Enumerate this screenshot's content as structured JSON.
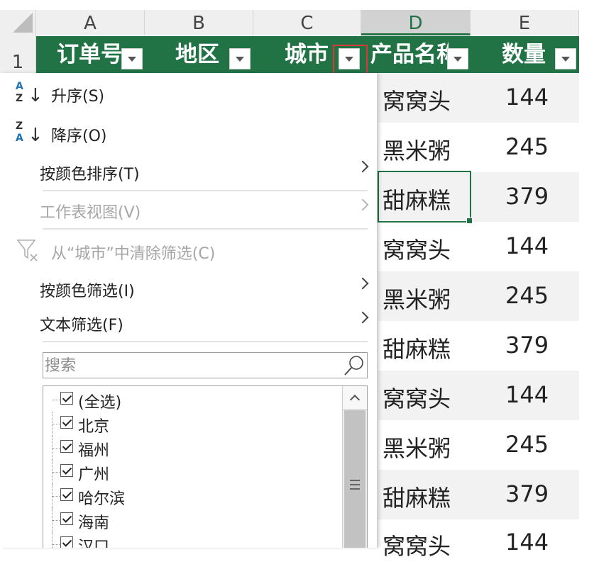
{
  "columns": [
    "A",
    "B",
    "C",
    "D",
    "E"
  ],
  "row_number": "1",
  "headers": [
    "订单号",
    "地区",
    "城市",
    "产品名称",
    "数量"
  ],
  "rows": [
    {
      "product": "窝窝头",
      "qty": "144"
    },
    {
      "product": "黑米粥",
      "qty": "245"
    },
    {
      "product": "甜麻糕",
      "qty": "379"
    },
    {
      "product": "窝窝头",
      "qty": "144"
    },
    {
      "product": "黑米粥",
      "qty": "245"
    },
    {
      "product": "甜麻糕",
      "qty": "379"
    },
    {
      "product": "窝窝头",
      "qty": "144"
    },
    {
      "product": "黑米粥",
      "qty": "245"
    },
    {
      "product": "甜麻糕",
      "qty": "379"
    },
    {
      "product": "窝窝头",
      "qty": "144"
    }
  ],
  "menu": {
    "sort_asc": "升序(S)",
    "sort_desc": "降序(O)",
    "sort_by_color": "按颜色排序(T)",
    "sheet_view": "工作表视图(V)",
    "clear_filter": "从“城市”中清除筛选(C)",
    "filter_by_color": "按颜色筛选(I)",
    "text_filter": "文本筛选(F)",
    "search_placeholder": "搜索",
    "sort_asc_icon": {
      "top": "A",
      "bottom": "Z"
    },
    "sort_desc_icon": {
      "top": "Z",
      "bottom": "A"
    },
    "items": [
      {
        "label": "(全选)",
        "checked": true
      },
      {
        "label": "北京",
        "checked": true
      },
      {
        "label": "福州",
        "checked": true
      },
      {
        "label": "广州",
        "checked": true
      },
      {
        "label": "哈尔滨",
        "checked": true
      },
      {
        "label": "海南",
        "checked": true
      },
      {
        "label": "汉口",
        "checked": true
      }
    ]
  },
  "colors": {
    "header_green": "#217346",
    "highlight_red": "#d9393a",
    "accent_blue": "#1e73b5"
  },
  "icons": [
    "sort-ascending-icon",
    "sort-descending-icon",
    "clear-filter-icon",
    "search-icon",
    "submenu-chevron-icon",
    "dropdown-arrow-icon",
    "scroll-up-icon",
    "scroll-grip-icon"
  ]
}
